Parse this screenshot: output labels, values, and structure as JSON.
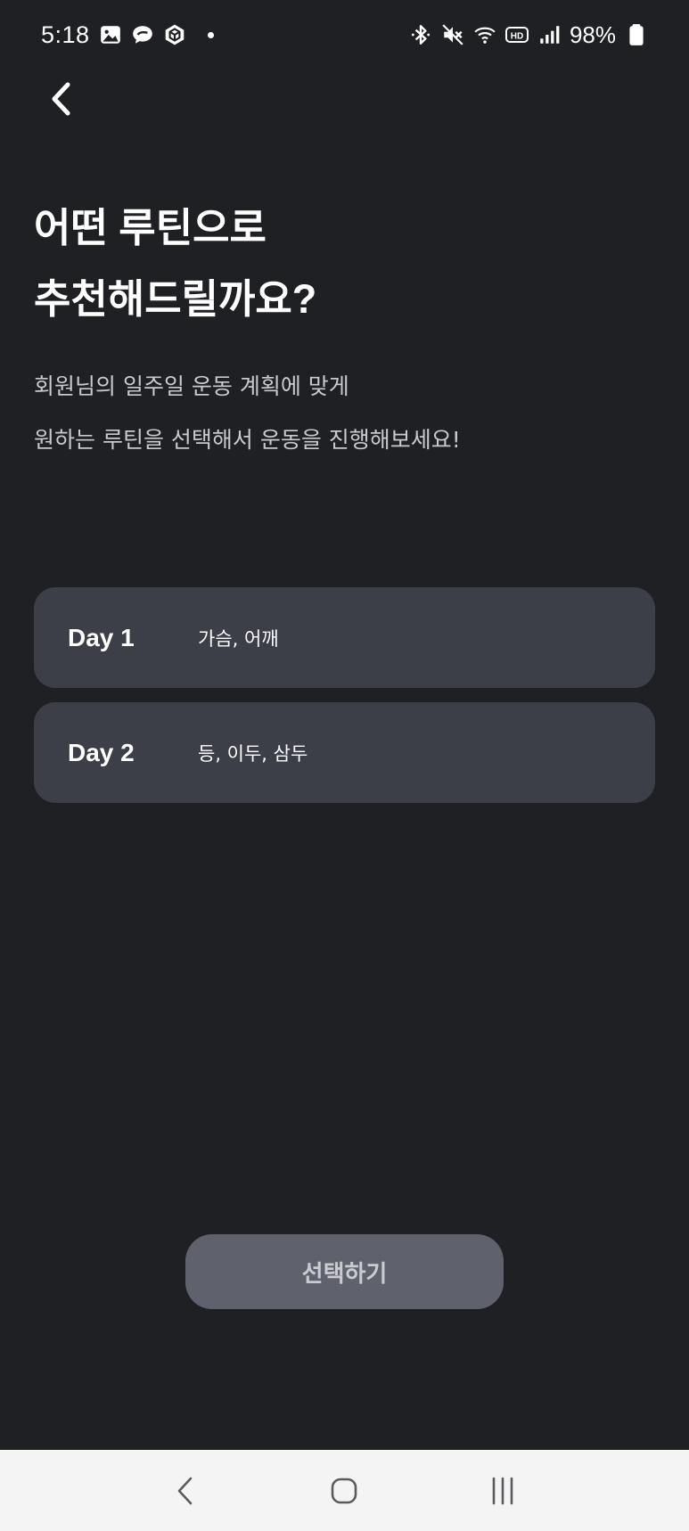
{
  "status_bar": {
    "time": "5:18",
    "battery": "98%",
    "left_icons": [
      "gallery-icon",
      "chat-bubble-icon",
      "cube-app-icon"
    ],
    "right_icons": [
      "bluetooth-icon",
      "mute-icon",
      "wifi-icon",
      "hd-icon",
      "signal-icon",
      "battery-icon"
    ]
  },
  "header": {
    "back_icon": "chevron-left-icon"
  },
  "title": {
    "line1": "어떤 루틴으로",
    "line2": "추천해드릴까요?"
  },
  "subtitle": {
    "line1": "회원님의 일주일 운동 계획에 맞게",
    "line2": "원하는 루틴을 선택해서 운동을 진행해보세요!"
  },
  "routines": [
    {
      "day": "Day 1",
      "parts": "가슴, 어깨"
    },
    {
      "day": "Day 2",
      "parts": "등, 이두, 삼두"
    }
  ],
  "select_button": {
    "label": "선택하기"
  },
  "nav_bar": {
    "icons": [
      "nav-back-icon",
      "nav-home-icon",
      "nav-recents-icon"
    ]
  },
  "colors": {
    "background": "#1f2024",
    "card": "#3c3f48",
    "button": "#5f626c",
    "button_text": "#c9cbd0",
    "subtitle_text": "#c9cacd",
    "nav_bar": "#f4f4f5"
  }
}
